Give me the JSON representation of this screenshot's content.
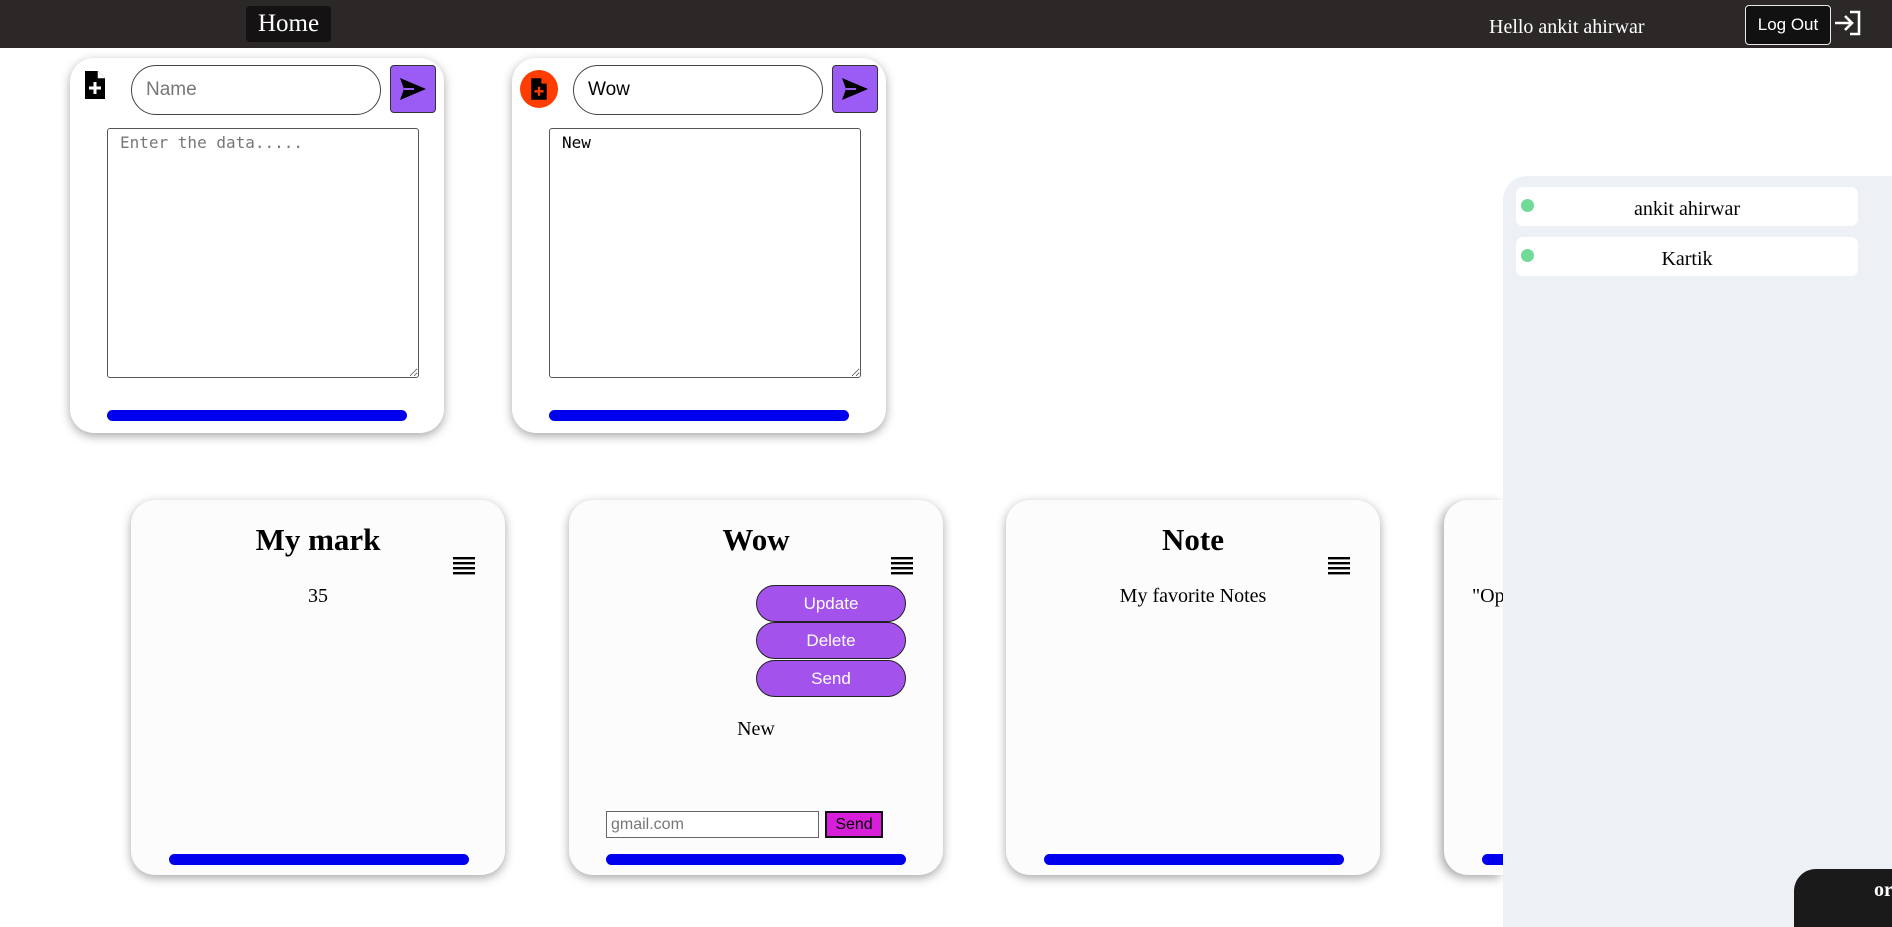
{
  "header": {
    "home_label": "Home",
    "greeting": "Hello ankit ahirwar",
    "logout_label": "Log Out"
  },
  "editors": [
    {
      "name_value": "",
      "name_placeholder": "Name",
      "data_value": "",
      "data_placeholder": "Enter the data.....",
      "icon": "file-plus-icon"
    },
    {
      "name_value": "Wow",
      "name_placeholder": "Name",
      "data_value": "New",
      "data_placeholder": "Enter the data.....",
      "icon": "file-plus-icon"
    }
  ],
  "notes": [
    {
      "title": "My mark",
      "body": "35"
    },
    {
      "title": "Wow",
      "body": "New",
      "actions": {
        "update": "Update",
        "delete": "Delete",
        "send": "Send"
      },
      "email_placeholder": "gmail.com",
      "email_send": "Send"
    },
    {
      "title": "Note",
      "body": "My favorite Notes"
    },
    {
      "title": "",
      "body": "\"Op"
    }
  ],
  "users": [
    {
      "name": "ankit ahirwar",
      "status": "online"
    },
    {
      "name": "Kartik",
      "status": "online"
    }
  ],
  "chat_pill_text": "or",
  "colors": {
    "topbar": "#2b2827",
    "accent_purple": "#9a5cf5",
    "action_purple": "#a352ec",
    "progress_blue": "#0000ee",
    "send_magenta": "#d71fd9",
    "online_green": "#6fdb97",
    "record_red": "#ff3d00"
  }
}
